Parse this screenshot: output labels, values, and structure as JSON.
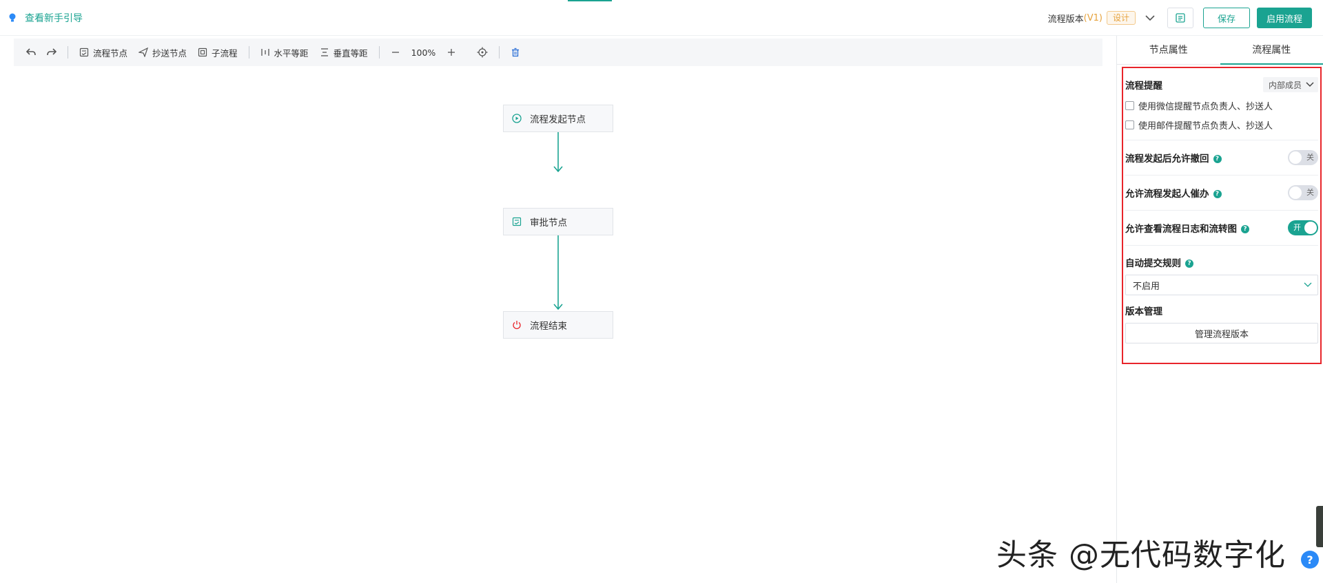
{
  "header": {
    "guide_label": "查看新手引导",
    "version_label": "流程版本",
    "version_value": "(V1)",
    "status_tag": "设计",
    "save_label": "保存",
    "enable_label": "启用流程"
  },
  "toolbar": {
    "flow_node": "流程节点",
    "cc_node": "抄送节点",
    "sub_flow": "子流程",
    "h_spacing": "水平等距",
    "v_spacing": "垂直等距",
    "zoom": "100%"
  },
  "nodes": [
    {
      "label": "流程发起节点",
      "icon": "play-icon"
    },
    {
      "label": "审批节点",
      "icon": "approval-icon"
    },
    {
      "label": "流程结束",
      "icon": "power-icon"
    }
  ],
  "panel": {
    "tabs": [
      "节点属性",
      "流程属性"
    ],
    "active_tab": "流程属性",
    "remind_title": "流程提醒",
    "remind_scope": "内部成员",
    "wechat_remind": "使用微信提醒节点负责人、抄送人",
    "email_remind": "使用邮件提醒节点负责人、抄送人",
    "allow_withdraw": "流程发起后允许撤回",
    "allow_withdraw_state": "关",
    "allow_urge": "允许流程发起人催办",
    "allow_urge_state": "关",
    "allow_view_log": "允许查看流程日志和流转图",
    "allow_view_log_state": "开",
    "auto_submit_title": "自动提交规则",
    "auto_submit_value": "不启用",
    "version_mgmt_title": "版本管理",
    "manage_versions_label": "管理流程版本"
  },
  "watermark": "头条 @无代码数字化",
  "colors": {
    "accent": "#1aa391",
    "warning": "#e6a23c",
    "highlight_border": "#e8242a"
  }
}
